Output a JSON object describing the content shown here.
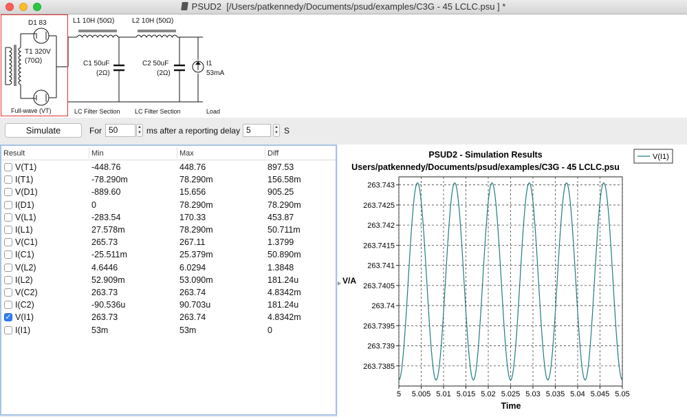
{
  "window": {
    "app": "PSUD2",
    "path": "[/Users/patkennedy/Documents/psud/examples/C3G - 45 LCLC.psu ] *"
  },
  "schematic": {
    "rectifier": {
      "diode": "D1 83",
      "transformer": "T1 320V",
      "resistance": "(70Ω)",
      "caption": "Full-wave (VT)"
    },
    "section1": {
      "inductor": "L1 10H (50Ω)",
      "cap": "C1 50uF",
      "cap_esr": "(2Ω)",
      "caption": "LC Filter Section"
    },
    "section2": {
      "inductor": "L2 10H (50Ω)",
      "cap": "C2 50uF",
      "cap_esr": "(2Ω)",
      "caption": "LC Filter Section"
    },
    "load": {
      "name": "I1",
      "value": "53mA",
      "caption": "Load"
    }
  },
  "controls": {
    "simulate": "Simulate",
    "for_label": "For",
    "duration": "50",
    "ms_label": "ms after a reporting delay",
    "delay": "5",
    "s_label": "S"
  },
  "table": {
    "headers": [
      "Result",
      "Min",
      "Max",
      "Diff"
    ],
    "rows": [
      {
        "name": "V(T1)",
        "min": "-448.76",
        "max": "448.76",
        "diff": "897.53",
        "checked": false
      },
      {
        "name": "I(T1)",
        "min": "-78.290m",
        "max": "78.290m",
        "diff": "156.58m",
        "checked": false
      },
      {
        "name": "V(D1)",
        "min": "-889.60",
        "max": "15.656",
        "diff": "905.25",
        "checked": false
      },
      {
        "name": "I(D1)",
        "min": "0",
        "max": "78.290m",
        "diff": "78.290m",
        "checked": false
      },
      {
        "name": "V(L1)",
        "min": "-283.54",
        "max": "170.33",
        "diff": "453.87",
        "checked": false
      },
      {
        "name": "I(L1)",
        "min": "27.578m",
        "max": "78.290m",
        "diff": "50.711m",
        "checked": false
      },
      {
        "name": "V(C1)",
        "min": "265.73",
        "max": "267.11",
        "diff": "1.3799",
        "checked": false
      },
      {
        "name": "I(C1)",
        "min": "-25.511m",
        "max": "25.379m",
        "diff": "50.890m",
        "checked": false
      },
      {
        "name": "V(L2)",
        "min": "4.6446",
        "max": "6.0294",
        "diff": "1.3848",
        "checked": false
      },
      {
        "name": "I(L2)",
        "min": "52.909m",
        "max": "53.090m",
        "diff": "181.24u",
        "checked": false
      },
      {
        "name": "V(C2)",
        "min": "263.73",
        "max": "263.74",
        "diff": "4.8342m",
        "checked": false
      },
      {
        "name": "I(C2)",
        "min": "-90.536u",
        "max": "90.703u",
        "diff": "181.24u",
        "checked": false
      },
      {
        "name": "V(I1)",
        "min": "263.73",
        "max": "263.74",
        "diff": "4.8342m",
        "checked": true
      },
      {
        "name": "I(I1)",
        "min": "53m",
        "max": "53m",
        "diff": "0",
        "checked": false
      }
    ]
  },
  "chart_data": {
    "type": "line",
    "title": "PSUD2 - Simulation Results",
    "subtitle": "Users/patkennedy/Documents/psud/examples/C3G - 45 LCLC.psu",
    "xlabel": "Time",
    "ylabel": "V/A",
    "xlim": [
      5,
      5.05
    ],
    "ylim": [
      263.738,
      263.7432
    ],
    "xticks": [
      "5",
      "5.005",
      "5.01",
      "5.015",
      "5.02",
      "5.025",
      "5.03",
      "5.035",
      "5.04",
      "5.045",
      "5.05"
    ],
    "yticks": [
      "263.743",
      "263.7425",
      "263.742",
      "263.7415",
      "263.741",
      "263.7405",
      "263.74",
      "263.7395",
      "263.739",
      "263.7385"
    ],
    "grid": true,
    "legend_position": "top-right",
    "series": [
      {
        "name": "V(I1)",
        "color": "#1f7a80",
        "type": "sine",
        "min": 263.73815,
        "max": 263.74305,
        "frequency_hz": 120,
        "start_phase": "minimum"
      }
    ]
  }
}
